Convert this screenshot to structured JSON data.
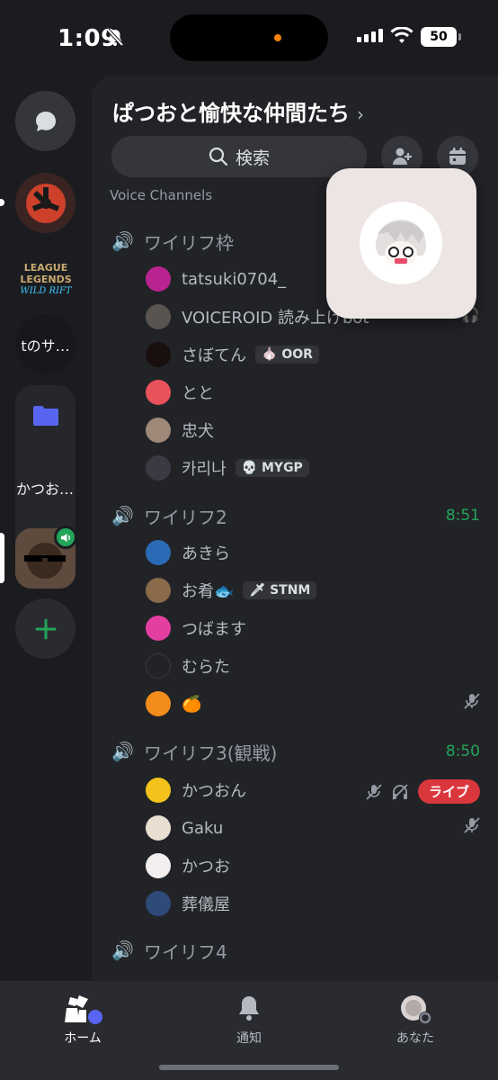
{
  "status_bar": {
    "time": "1:09",
    "battery": "50"
  },
  "rail": {
    "server_tnosa": "tのサ…",
    "folder_label": "かつお…"
  },
  "guild": {
    "title": "ぱつおと愉快な仲間たち",
    "search_label": "検索",
    "section_header": "Voice Channels"
  },
  "channels": [
    {
      "name": "ワイリフ枠",
      "duration": "",
      "users": [
        {
          "name": "tatsuki0704_",
          "tag": ""
        },
        {
          "name": "VOICEROID 読み上げbot",
          "tag": ""
        },
        {
          "name": "さぼてん",
          "tag": "OOR"
        },
        {
          "name": "とと",
          "tag": ""
        },
        {
          "name": "忠犬",
          "tag": ""
        },
        {
          "name": "카리나",
          "tag": "MYGP"
        }
      ]
    },
    {
      "name": "ワイリフ2",
      "duration": "8:51",
      "users": [
        {
          "name": "あきら",
          "tag": ""
        },
        {
          "name": "お肴🐟",
          "tag": "STNM"
        },
        {
          "name": "つばます",
          "tag": ""
        },
        {
          "name": "むらた",
          "tag": ""
        },
        {
          "name": "🍊",
          "tag": ""
        }
      ]
    },
    {
      "name": "ワイリフ3(観戦)",
      "duration": "8:50",
      "users": [
        {
          "name": "かつおん",
          "tag": "",
          "badge": "ライブ"
        },
        {
          "name": "Gaku",
          "tag": ""
        },
        {
          "name": "かつお",
          "tag": ""
        },
        {
          "name": "葬儀屋",
          "tag": ""
        }
      ]
    },
    {
      "name": "ワイリフ4",
      "duration": ""
    }
  ],
  "tabs": {
    "home": "ホーム",
    "notifications": "通知",
    "you": "あなた"
  },
  "colors": {
    "voice_green": "#23a55a",
    "live_red": "#da373c",
    "accent_blurple": "#5865f2"
  }
}
